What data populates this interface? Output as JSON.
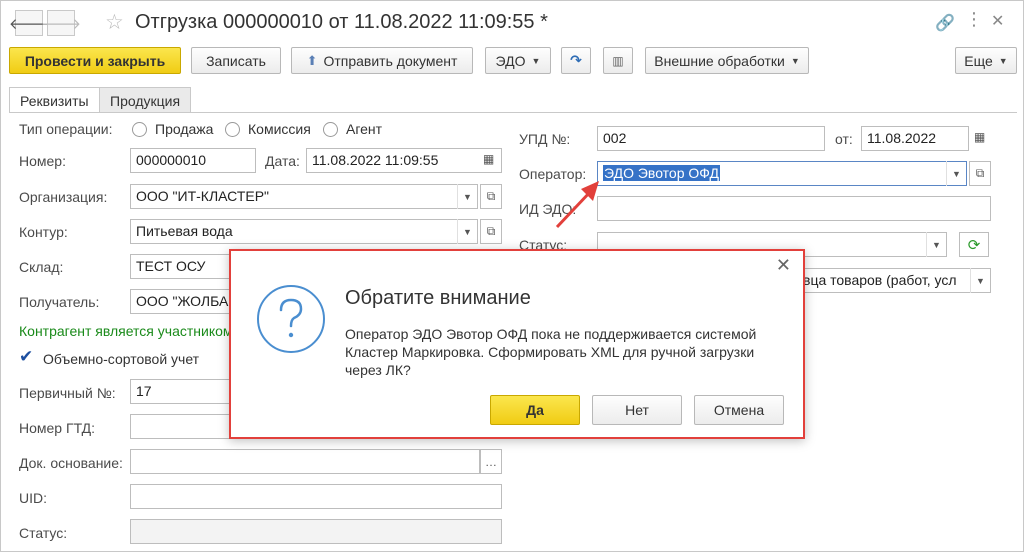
{
  "titlebar": {
    "title": "Отгрузка 000000010 от 11.08.2022 11:09:55 *"
  },
  "toolbar": {
    "post_close": "Провести и закрыть",
    "write": "Записать",
    "send_doc": "Отправить документ",
    "edo": "ЭДО",
    "external": "Внешние обработки",
    "more": "Еще"
  },
  "tabs": [
    {
      "label": "Реквизиты",
      "active": true
    },
    {
      "label": "Продукция",
      "active": false
    }
  ],
  "form": {
    "op_type_label": "Тип операции:",
    "op_types": [
      "Продажа",
      "Комиссия",
      "Агент"
    ],
    "number_label": "Номер:",
    "number_value": "000000010",
    "date_label": "Дата:",
    "date_value": "11.08.2022 11:09:55",
    "org_label": "Организация:",
    "org_value": "ООО \"ИТ-КЛАСТЕР\"",
    "contour_label": "Контур:",
    "contour_value": "Питьевая вода",
    "warehouse_label": "Склад:",
    "warehouse_value": "ТЕСТ ОСУ",
    "recipient_label": "Получатель:",
    "recipient_value": "ООО \"ЖОЛБА",
    "participant_note": "Контрагент является участником",
    "bulk_label": "Объемно-сортовой учет",
    "primary_label": "Первичный №:",
    "primary_value": "17",
    "gtd_label": "Номер ГТД:",
    "base_label": "Док. основание:",
    "uid_label": "UID:",
    "status_label": "Статус:"
  },
  "right": {
    "upd_label": "УПД №:",
    "upd_value": "002",
    "from_label": "от:",
    "from_value": "11.08.2022",
    "operator_label": "Оператор:",
    "operator_value": "ЭДО Эвотор ОФД",
    "edo_id_label": "ИД ЭДО:",
    "status_label": "Статус:",
    "seller_value": "вца товаров (работ, усл"
  },
  "dialog": {
    "title": "Обратите внимание",
    "message": "Оператор ЭДО Эвотор ОФД пока не поддерживается системой Кластер Маркировка. Сформировать XML для ручной загрузки через ЛК?",
    "yes": "Да",
    "no": "Нет",
    "cancel": "Отмена"
  },
  "colors": {
    "primary_button": "#f5d41f",
    "annotation_red": "#e2403b",
    "green_text": "#1a8a1a",
    "selection": "#3572c7"
  }
}
